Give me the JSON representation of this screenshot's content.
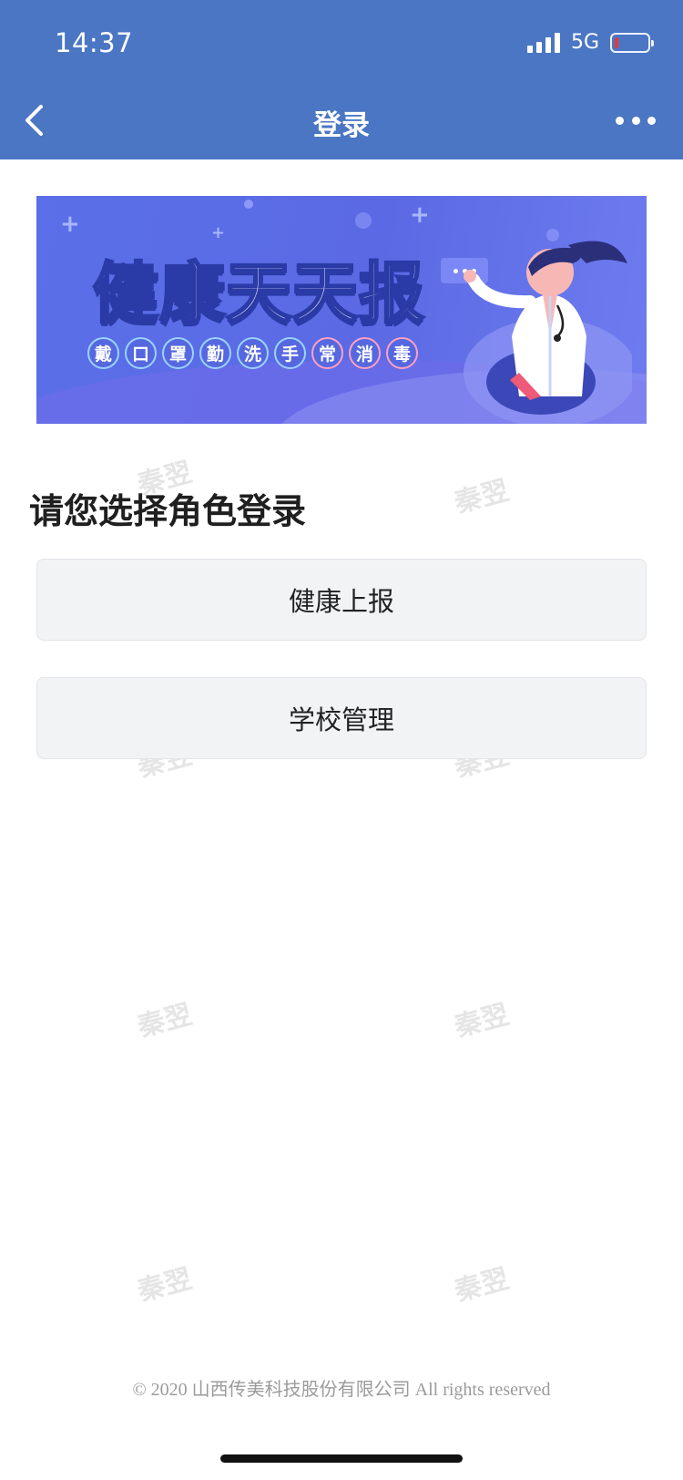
{
  "status_bar": {
    "time": "14:37",
    "network": "5G",
    "battery_level": 0.12,
    "battery_color": "#e23b3b"
  },
  "nav": {
    "title": "登录",
    "back_icon": "chevron-left-icon",
    "more_icon": "more-horizontal-icon",
    "color": "#4b76c4"
  },
  "banner": {
    "headline": "健康天天报",
    "chips": [
      "戴",
      "口",
      "罩",
      "勤",
      "洗",
      "手",
      "常",
      "消",
      "毒"
    ]
  },
  "main": {
    "prompt": "请您选择角色登录",
    "roles": [
      {
        "label": "健康上报"
      },
      {
        "label": "学校管理"
      }
    ]
  },
  "watermark": "秦翌",
  "footer": {
    "copyright": "© 2020 山西传美科技股份有限公司 All rights reserved"
  }
}
